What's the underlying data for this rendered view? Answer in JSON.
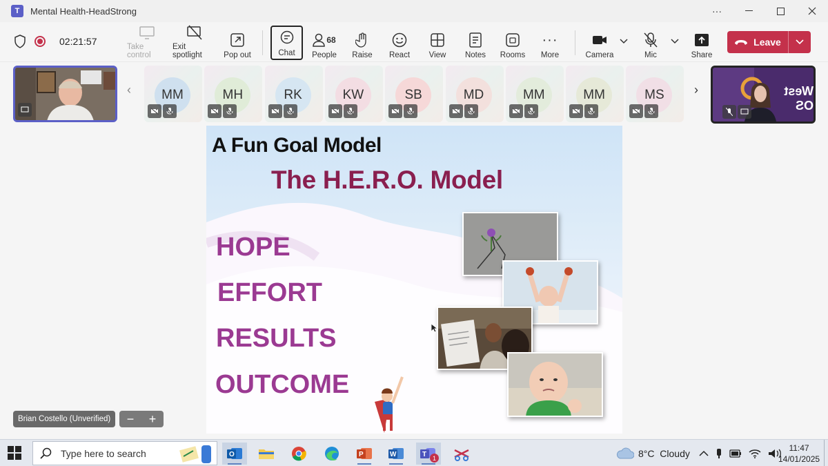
{
  "window": {
    "title": "Mental Health-HeadStrong"
  },
  "toolbar": {
    "timer": "02:21:57",
    "take_control": "Take control",
    "exit_spotlight": "Exit spotlight",
    "pop_out": "Pop out",
    "chat": "Chat",
    "people": "People",
    "people_count": "68",
    "raise": "Raise",
    "react": "React",
    "view": "View",
    "notes": "Notes",
    "rooms": "Rooms",
    "more": "More",
    "camera": "Camera",
    "mic": "Mic",
    "share": "Share",
    "leave": "Leave"
  },
  "participants": [
    {
      "initials": "MM",
      "color": "#cfe0ef"
    },
    {
      "initials": "MH",
      "color": "#e0ecd8"
    },
    {
      "initials": "RK",
      "color": "#d6e6f2"
    },
    {
      "initials": "KW",
      "color": "#f3dde3"
    },
    {
      "initials": "SB",
      "color": "#f6d8d8"
    },
    {
      "initials": "MD",
      "color": "#f3e0dd"
    },
    {
      "initials": "MM",
      "color": "#e3ecdc"
    },
    {
      "initials": "MM",
      "color": "#e6e9d8"
    },
    {
      "initials": "MS",
      "color": "#f1dfe6"
    }
  ],
  "spotlight": {
    "overlay_text": "West OS"
  },
  "slide": {
    "title": "A Fun Goal Model",
    "subtitle": "The H.E.R.O. Model",
    "words": [
      "HOPE",
      "EFFORT",
      "RESULTS",
      "OUTCOME"
    ]
  },
  "presenter": {
    "name": "Brian Costello (Unverified)"
  },
  "taskbar": {
    "search_placeholder": "Type here to search",
    "weather": "8°C  Cloudy",
    "time": "11:47",
    "date": "14/01/2025",
    "teams_badge": "1"
  },
  "colors": {
    "leave": "#c4314b",
    "accent": "#5b5fc7",
    "hero_text": "#9b3a92",
    "subtitle": "#8a1f4f"
  }
}
